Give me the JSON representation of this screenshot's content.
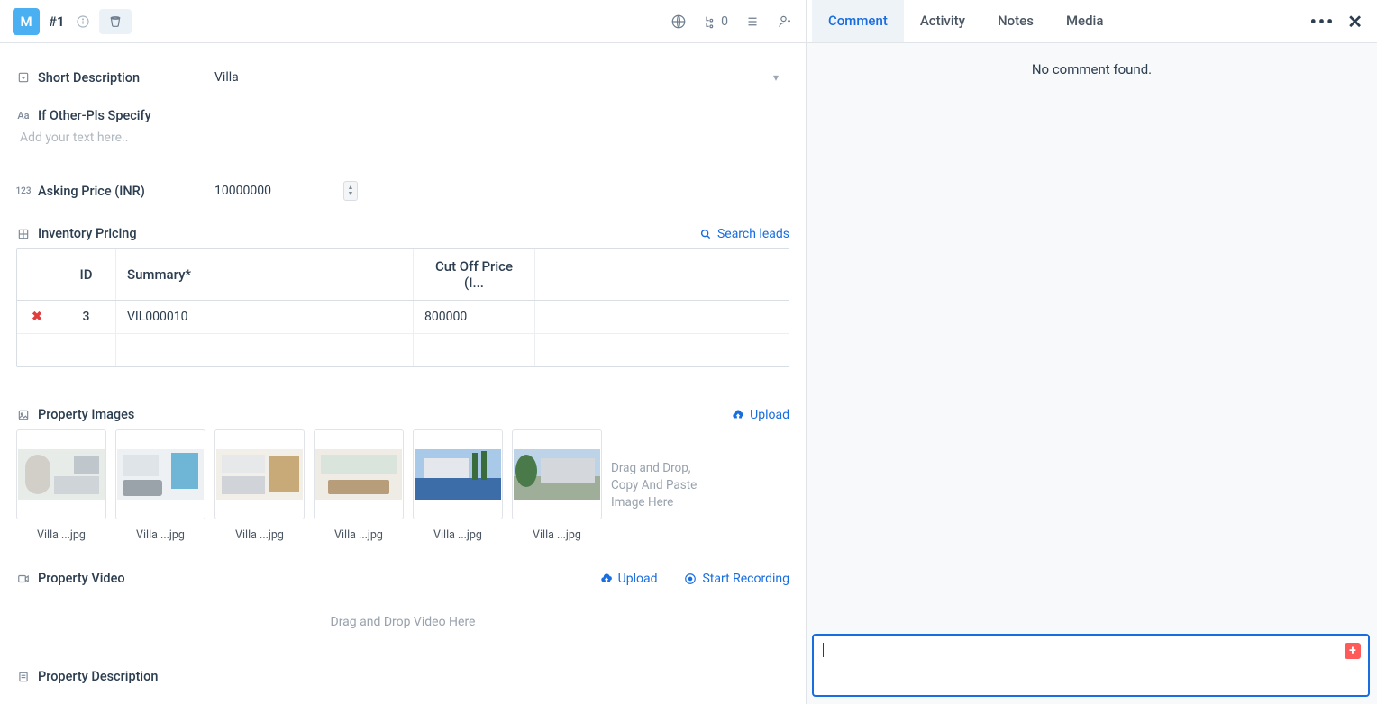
{
  "header": {
    "avatar_initial": "M",
    "record_id": "#1",
    "count_badge": "0"
  },
  "fields": {
    "short_description": {
      "label": "Short Description",
      "value": "Villa"
    },
    "other_specify": {
      "label": "If Other-Pls Specify",
      "placeholder": "Add your text here.."
    },
    "asking_price": {
      "label": "Asking Price (INR)",
      "value": "10000000"
    },
    "inventory_pricing": {
      "label": "Inventory Pricing",
      "search_link": "Search leads"
    },
    "property_images": {
      "label": "Property Images",
      "upload_link": "Upload"
    },
    "property_video": {
      "label": "Property Video",
      "upload_link": "Upload",
      "record_link": "Start Recording",
      "drop_hint": "Drag and Drop Video Here"
    },
    "property_description": {
      "label": "Property Description"
    }
  },
  "pricing_table": {
    "columns": {
      "id": "ID",
      "summary": "Summary*",
      "cutoff": "Cut Off Price (I..."
    },
    "rows": [
      {
        "id": "3",
        "summary": "VIL000010",
        "cutoff": "800000"
      }
    ]
  },
  "images": {
    "thumbs": [
      {
        "name": "Villa ...jpg"
      },
      {
        "name": "Villa ...jpg"
      },
      {
        "name": "Villa ...jpg"
      },
      {
        "name": "Villa ...jpg"
      },
      {
        "name": "Villa ...jpg"
      },
      {
        "name": "Villa ...jpg"
      }
    ],
    "drop_hint": "Drag and Drop, Copy And Paste Image Here"
  },
  "side": {
    "tabs": {
      "comment": "Comment",
      "activity": "Activity",
      "notes": "Notes",
      "media": "Media"
    },
    "empty": "No comment found."
  }
}
